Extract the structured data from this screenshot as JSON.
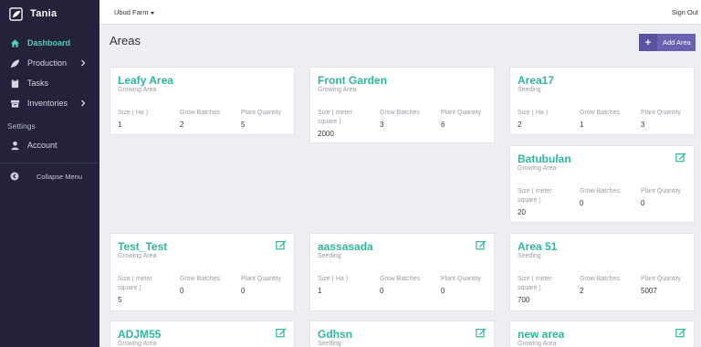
{
  "app": {
    "name": "Tania"
  },
  "sidebar": {
    "items": [
      {
        "label": "Dashboard",
        "icon": "home-icon"
      },
      {
        "label": "Production",
        "icon": "leaf-icon"
      },
      {
        "label": "Tasks",
        "icon": "clipboard-icon"
      },
      {
        "label": "Inventories",
        "icon": "archive-icon"
      }
    ],
    "settings_label": "Settings",
    "account_label": "Account",
    "collapse_label": "Collapse Menu"
  },
  "topbar": {
    "farm": "Ubud Farm",
    "signout": "Sign Out"
  },
  "page": {
    "title": "Areas",
    "add_label": "Add Area"
  },
  "stat_labels": {
    "size_ha": "Size ( Ha )",
    "size_m2": "Size ( meter square )",
    "batches": "Grow Batches",
    "qty": "Plant Quantity"
  },
  "areas": [
    {
      "name": "Leafy Area",
      "type": "Growing Area",
      "size_label": "Size ( Ha )",
      "size": "1",
      "batches": "2",
      "qty": "5"
    },
    {
      "name": "Front Garden",
      "type": "Growing Area",
      "size_label": "Size ( meter square )",
      "size": "2000",
      "batches": "3",
      "qty": "6"
    },
    {
      "name": "Area17",
      "type": "Seeding",
      "size_label": "Size ( Ha )",
      "size": "2",
      "batches": "1",
      "qty": "3"
    },
    {
      "name": "Batubulan",
      "type": "Growing Area",
      "size_label": "Size ( meter square )",
      "size": "20",
      "batches": "0",
      "qty": "0"
    },
    {
      "name": "Test_Test",
      "type": "Growing Area",
      "size_label": "Size ( meter square )",
      "size": "5",
      "batches": "0",
      "qty": "0"
    },
    {
      "name": "aassasada",
      "type": "Seeding",
      "size_label": "Size ( Ha )",
      "size": "1",
      "batches": "0",
      "qty": "0"
    },
    {
      "name": "Area 51",
      "type": "Seeding",
      "size_label": "Size ( meter square )",
      "size": "700",
      "batches": "2",
      "qty": "5007"
    },
    {
      "name": "ADJM55",
      "type": "Growing Area"
    },
    {
      "name": "Gdhsn",
      "type": "Seeding"
    },
    {
      "name": "new area",
      "type": "Growing Area"
    }
  ],
  "colors": {
    "sidebar": "#23223a",
    "accent": "#2eb6a0",
    "button": "#6a61b0"
  }
}
